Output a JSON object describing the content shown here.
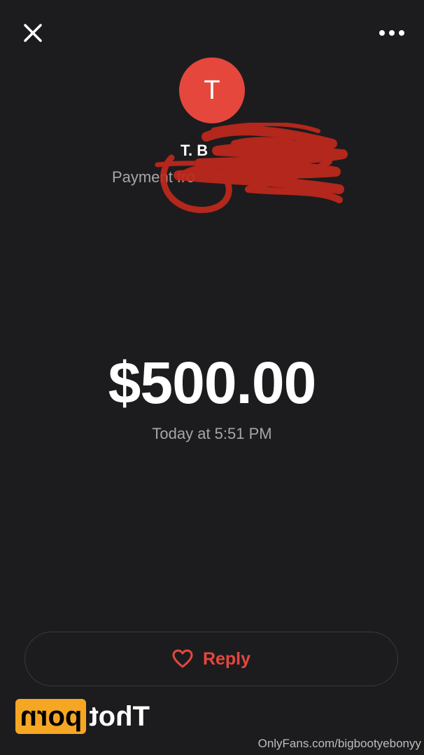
{
  "header": {
    "close_icon": "close-icon",
    "more_icon": "more-horizontal-icon"
  },
  "profile": {
    "avatar_initial": "T",
    "avatar_color": "#e5473d",
    "name_visible": "T. B",
    "subtitle_visible": "Payment fro"
  },
  "payment": {
    "amount": "$500.00",
    "timestamp": "Today at 5:51 PM"
  },
  "actions": {
    "reply_label": "Reply",
    "reply_icon": "heart-icon",
    "accent_color": "#e5473d"
  },
  "watermark": {
    "logo_word_1": "Thot",
    "logo_word_2": "porn",
    "url": "OnlyFans.com/bigbootyebonyy"
  }
}
